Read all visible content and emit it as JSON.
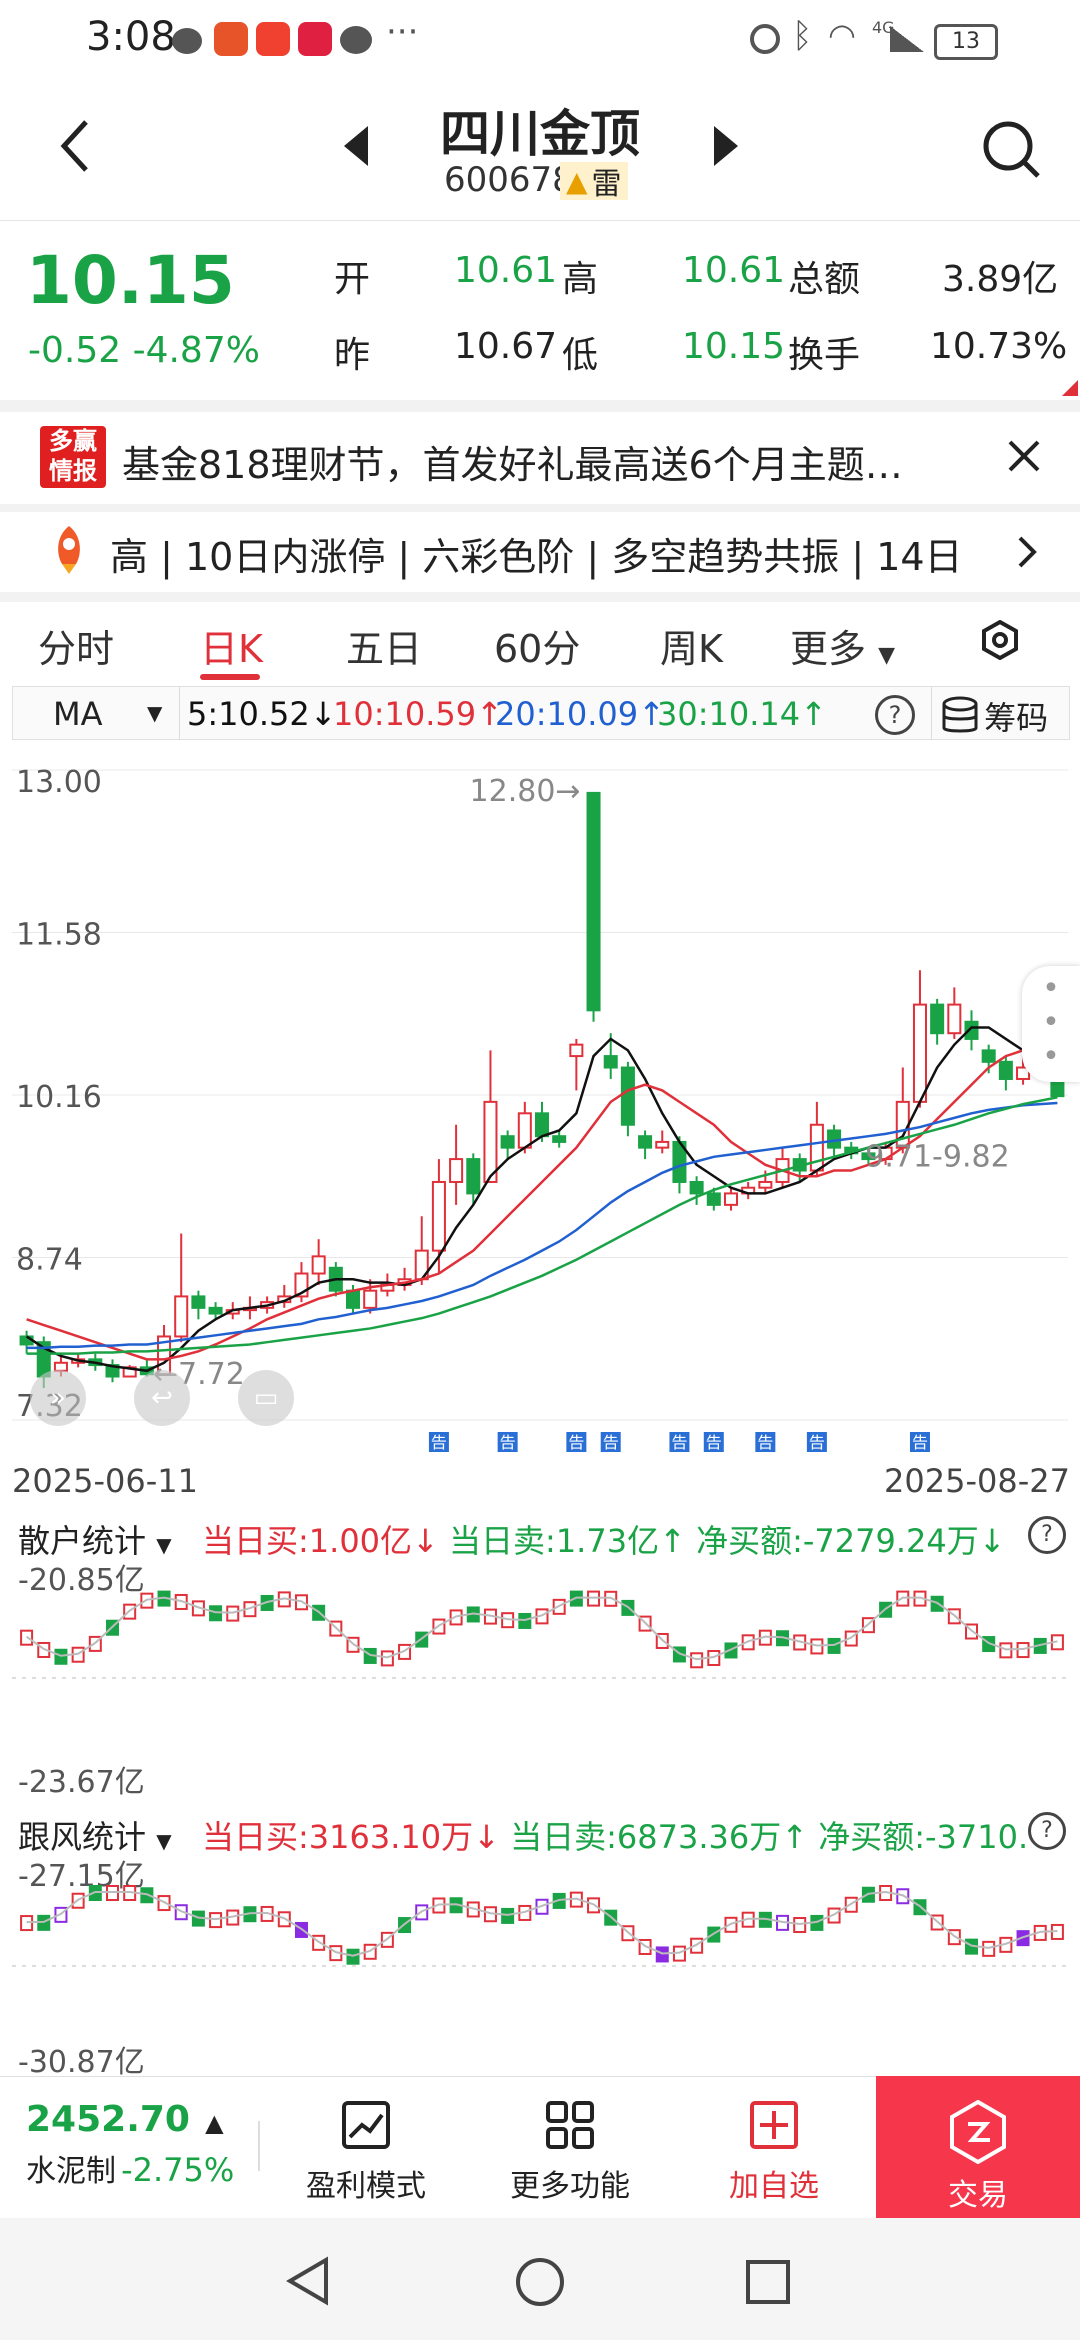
{
  "status_bar": {
    "time": "3:08",
    "battery": "13",
    "network": "4G"
  },
  "header": {
    "back_icon": "chevron-left-icon",
    "stock_name": "四川金顶",
    "stock_code": "600678",
    "badge": "雷",
    "search_icon": "search-icon"
  },
  "quote": {
    "price": "10.15",
    "change": "-0.52 -4.87%",
    "open_label": "开",
    "open_value": "10.61",
    "high_label": "高",
    "high_value": "10.61",
    "amount_label": "总额",
    "amount_value": "3.89亿",
    "prev_label": "昨",
    "prev_value": "10.67",
    "low_label": "低",
    "low_value": "10.15",
    "turnover_label": "换手",
    "turnover_value": "10.73%"
  },
  "ad": {
    "logo_line1": "多赢",
    "logo_line2": "情报",
    "text": "基金818理财节，首发好礼最高送6个月主题…"
  },
  "ticker": {
    "text": "高 | 10日内涨停 | 六彩色阶 | 多空趋势共振 | 14日"
  },
  "tabs": [
    "分时",
    "日K",
    "五日",
    "60分",
    "周K",
    "更多"
  ],
  "active_tab": "日K",
  "ma_bar": {
    "selector": "MA",
    "ma5": "5:10.52↓",
    "ma10": "10:10.59↑",
    "ma20": "20:10.09↑",
    "ma30": "30:10.14↑",
    "chips_label": "筹码"
  },
  "colors": {
    "up": "#e0303a",
    "down": "#1aa346",
    "ma5": "#111111",
    "ma10": "#e0303a",
    "ma20": "#2060d0",
    "ma30": "#1aa346",
    "trade_bg": "#f5364b"
  },
  "chart_data": {
    "type": "candlestick",
    "y_ticks": [
      "13.00",
      "11.58",
      "10.16",
      "8.74",
      "7.32"
    ],
    "ylim": [
      7.32,
      13.0
    ],
    "x_start": "2025-06-11",
    "x_end": "2025-08-27",
    "annotations": {
      "high": "12.80",
      "low": "7.72",
      "range": "9.71-9.82"
    },
    "notice_marker": "告",
    "candles": [
      {
        "o": 8.05,
        "c": 7.98,
        "h": 8.1,
        "l": 7.9
      },
      {
        "o": 8.0,
        "c": 7.7,
        "h": 8.05,
        "l": 7.6
      },
      {
        "o": 7.75,
        "c": 7.82,
        "h": 7.9,
        "l": 7.7
      },
      {
        "o": 7.82,
        "c": 7.85,
        "h": 7.9,
        "l": 7.78
      },
      {
        "o": 7.85,
        "c": 7.8,
        "h": 7.9,
        "l": 7.75
      },
      {
        "o": 7.8,
        "c": 7.7,
        "h": 7.85,
        "l": 7.65
      },
      {
        "o": 7.7,
        "c": 7.78,
        "h": 7.8,
        "l": 7.7
      },
      {
        "o": 7.78,
        "c": 7.72,
        "h": 7.85,
        "l": 7.7
      },
      {
        "o": 7.72,
        "c": 8.05,
        "h": 8.15,
        "l": 7.72
      },
      {
        "o": 8.05,
        "c": 8.4,
        "h": 8.95,
        "l": 8.0
      },
      {
        "o": 8.4,
        "c": 8.3,
        "h": 8.45,
        "l": 8.2
      },
      {
        "o": 8.3,
        "c": 8.25,
        "h": 8.35,
        "l": 8.2
      },
      {
        "o": 8.25,
        "c": 8.28,
        "h": 8.35,
        "l": 8.2
      },
      {
        "o": 8.28,
        "c": 8.3,
        "h": 8.4,
        "l": 8.2
      },
      {
        "o": 8.3,
        "c": 8.35,
        "h": 8.4,
        "l": 8.25
      },
      {
        "o": 8.35,
        "c": 8.4,
        "h": 8.5,
        "l": 8.3
      },
      {
        "o": 8.4,
        "c": 8.6,
        "h": 8.7,
        "l": 8.35
      },
      {
        "o": 8.6,
        "c": 8.75,
        "h": 8.9,
        "l": 8.5
      },
      {
        "o": 8.65,
        "c": 8.45,
        "h": 8.7,
        "l": 8.4
      },
      {
        "o": 8.45,
        "c": 8.3,
        "h": 8.5,
        "l": 8.25
      },
      {
        "o": 8.3,
        "c": 8.45,
        "h": 8.55,
        "l": 8.25
      },
      {
        "o": 8.45,
        "c": 8.5,
        "h": 8.6,
        "l": 8.4
      },
      {
        "o": 8.5,
        "c": 8.55,
        "h": 8.65,
        "l": 8.45
      },
      {
        "o": 8.55,
        "c": 8.8,
        "h": 9.1,
        "l": 8.5
      },
      {
        "o": 8.8,
        "c": 9.4,
        "h": 9.6,
        "l": 8.6
      },
      {
        "o": 9.4,
        "c": 9.6,
        "h": 9.9,
        "l": 9.2
      },
      {
        "o": 9.6,
        "c": 9.3,
        "h": 9.65,
        "l": 9.2
      },
      {
        "o": 9.4,
        "c": 10.1,
        "h": 10.55,
        "l": 9.4
      },
      {
        "o": 9.8,
        "c": 9.7,
        "h": 9.85,
        "l": 9.6
      },
      {
        "o": 9.7,
        "c": 10.0,
        "h": 10.1,
        "l": 9.65
      },
      {
        "o": 10.0,
        "c": 9.8,
        "h": 10.1,
        "l": 9.75
      },
      {
        "o": 9.8,
        "c": 9.75,
        "h": 9.85,
        "l": 9.7
      },
      {
        "o": 10.5,
        "c": 10.6,
        "h": 10.65,
        "l": 10.2
      },
      {
        "o": 12.8,
        "c": 10.9,
        "h": 12.8,
        "l": 10.8
      },
      {
        "o": 10.5,
        "c": 10.4,
        "h": 10.7,
        "l": 10.3
      },
      {
        "o": 10.4,
        "c": 9.9,
        "h": 10.45,
        "l": 9.8
      },
      {
        "o": 9.8,
        "c": 9.7,
        "h": 9.85,
        "l": 9.6
      },
      {
        "o": 9.7,
        "c": 9.75,
        "h": 9.85,
        "l": 9.65
      },
      {
        "o": 9.75,
        "c": 9.4,
        "h": 9.8,
        "l": 9.3
      },
      {
        "o": 9.4,
        "c": 9.3,
        "h": 9.45,
        "l": 9.2
      },
      {
        "o": 9.3,
        "c": 9.2,
        "h": 9.35,
        "l": 9.15
      },
      {
        "o": 9.2,
        "c": 9.3,
        "h": 9.35,
        "l": 9.15
      },
      {
        "o": 9.3,
        "c": 9.35,
        "h": 9.4,
        "l": 9.25
      },
      {
        "o": 9.35,
        "c": 9.4,
        "h": 9.5,
        "l": 9.3
      },
      {
        "o": 9.4,
        "c": 9.6,
        "h": 9.7,
        "l": 9.35
      },
      {
        "o": 9.6,
        "c": 9.5,
        "h": 9.65,
        "l": 9.4
      },
      {
        "o": 9.5,
        "c": 9.9,
        "h": 10.1,
        "l": 9.45
      },
      {
        "o": 9.85,
        "c": 9.7,
        "h": 9.9,
        "l": 9.6
      },
      {
        "o": 9.7,
        "c": 9.65,
        "h": 9.75,
        "l": 9.6
      },
      {
        "o": 9.65,
        "c": 9.6,
        "h": 9.7,
        "l": 9.55
      },
      {
        "o": 9.6,
        "c": 9.7,
        "h": 9.75,
        "l": 9.55
      },
      {
        "o": 9.7,
        "c": 10.1,
        "h": 10.4,
        "l": 9.65
      },
      {
        "o": 10.1,
        "c": 10.95,
        "h": 11.25,
        "l": 10.05
      },
      {
        "o": 10.95,
        "c": 10.7,
        "h": 11.0,
        "l": 10.6
      },
      {
        "o": 10.7,
        "c": 10.95,
        "h": 11.1,
        "l": 10.65
      },
      {
        "o": 10.8,
        "c": 10.65,
        "h": 10.9,
        "l": 10.55
      },
      {
        "o": 10.55,
        "c": 10.45,
        "h": 10.6,
        "l": 10.35
      },
      {
        "o": 10.45,
        "c": 10.3,
        "h": 10.5,
        "l": 10.2
      },
      {
        "o": 10.3,
        "c": 10.4,
        "h": 10.5,
        "l": 10.25
      },
      {
        "o": 10.4,
        "c": 10.5,
        "h": 10.55,
        "l": 10.35
      },
      {
        "o": 10.67,
        "c": 10.15,
        "h": 10.67,
        "l": 10.15
      }
    ],
    "ma5": [
      8.05,
      7.95,
      7.88,
      7.84,
      7.82,
      7.79,
      7.77,
      7.75,
      7.82,
      7.95,
      8.1,
      8.2,
      8.28,
      8.3,
      8.32,
      8.36,
      8.43,
      8.52,
      8.55,
      8.55,
      8.52,
      8.52,
      8.5,
      8.55,
      8.75,
      9.0,
      9.2,
      9.45,
      9.6,
      9.7,
      9.8,
      9.85,
      10.0,
      10.5,
      10.65,
      10.55,
      10.3,
      10.0,
      9.75,
      9.55,
      9.45,
      9.35,
      9.3,
      9.3,
      9.35,
      9.4,
      9.5,
      9.6,
      9.65,
      9.7,
      9.7,
      9.8,
      10.1,
      10.4,
      10.6,
      10.75,
      10.75,
      10.65,
      10.55,
      10.5,
      10.52
    ],
    "ma10": [
      8.2,
      8.15,
      8.1,
      8.05,
      8.0,
      7.95,
      7.9,
      7.85,
      7.85,
      7.88,
      7.92,
      7.98,
      8.05,
      8.12,
      8.2,
      8.26,
      8.32,
      8.38,
      8.42,
      8.45,
      8.48,
      8.5,
      8.52,
      8.55,
      8.6,
      8.7,
      8.8,
      8.95,
      9.1,
      9.25,
      9.4,
      9.55,
      9.7,
      9.9,
      10.1,
      10.2,
      10.25,
      10.2,
      10.1,
      10.0,
      9.9,
      9.75,
      9.65,
      9.55,
      9.5,
      9.45,
      9.45,
      9.5,
      9.5,
      9.55,
      9.6,
      9.7,
      9.8,
      9.95,
      10.1,
      10.25,
      10.4,
      10.5,
      10.55,
      10.58,
      10.59
    ],
    "ma20": [
      7.95,
      7.95,
      7.96,
      7.96,
      7.97,
      7.97,
      7.98,
      7.98,
      8.0,
      8.02,
      8.04,
      8.06,
      8.08,
      8.1,
      8.12,
      8.14,
      8.16,
      8.2,
      8.22,
      8.25,
      8.28,
      8.3,
      8.33,
      8.36,
      8.4,
      8.45,
      8.5,
      8.58,
      8.65,
      8.72,
      8.8,
      8.88,
      8.98,
      9.1,
      9.22,
      9.32,
      9.4,
      9.48,
      9.54,
      9.58,
      9.62,
      9.64,
      9.66,
      9.68,
      9.7,
      9.72,
      9.74,
      9.76,
      9.78,
      9.8,
      9.82,
      9.85,
      9.88,
      9.92,
      9.96,
      10.0,
      10.03,
      10.05,
      10.07,
      10.08,
      10.09
    ],
    "ma30": [
      7.9,
      7.9,
      7.9,
      7.9,
      7.91,
      7.91,
      7.92,
      7.92,
      7.93,
      7.94,
      7.95,
      7.96,
      7.97,
      7.98,
      8.0,
      8.02,
      8.04,
      8.06,
      8.08,
      8.1,
      8.12,
      8.15,
      8.18,
      8.21,
      8.25,
      8.3,
      8.35,
      8.4,
      8.46,
      8.52,
      8.58,
      8.65,
      8.72,
      8.8,
      8.88,
      8.96,
      9.04,
      9.12,
      9.2,
      9.27,
      9.33,
      9.38,
      9.42,
      9.46,
      9.5,
      9.54,
      9.58,
      9.62,
      9.66,
      9.7,
      9.74,
      9.78,
      9.82,
      9.86,
      9.9,
      9.95,
      10.0,
      10.04,
      10.08,
      10.11,
      10.14
    ],
    "notice_positions": [
      24,
      28,
      32,
      34,
      38,
      40,
      43,
      46,
      52
    ]
  },
  "retail_stats": {
    "title": "散户统计",
    "buy": "当日买:1.00亿↓",
    "sell": "当日卖:1.73亿↑",
    "net": "净买额:-7279.24万↓",
    "y_top": "-20.85亿",
    "y_bottom": "-23.67亿"
  },
  "follow_stats": {
    "title": "跟风统计",
    "buy": "当日买:3163.10万↓",
    "sell": "当日卖:6873.36万↑",
    "net": "净买额:-3710.",
    "y_top": "-27.15亿",
    "y_bottom": "-30.87亿"
  },
  "bottom_bar": {
    "index_value": "2452.70",
    "index_arrow": "▲",
    "index_name": "水泥制",
    "index_change": "-2.75%",
    "profit_mode": "盈利模式",
    "more_functions": "更多功能",
    "add_watchlist": "加自选",
    "trade": "交易"
  }
}
